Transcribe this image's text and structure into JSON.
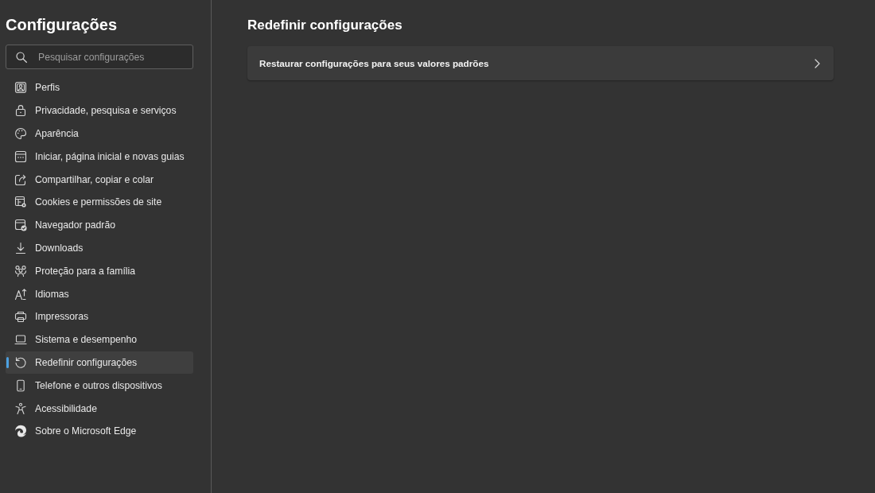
{
  "sidebar": {
    "title": "Configurações",
    "search": {
      "placeholder": "Pesquisar configurações"
    },
    "items": [
      {
        "label": "Perfis",
        "selected": false
      },
      {
        "label": "Privacidade, pesquisa e serviços",
        "selected": false
      },
      {
        "label": "Aparência",
        "selected": false
      },
      {
        "label": "Iniciar, página inicial e novas guias",
        "selected": false
      },
      {
        "label": "Compartilhar, copiar e colar",
        "selected": false
      },
      {
        "label": "Cookies e permissões de site",
        "selected": false
      },
      {
        "label": "Navegador padrão",
        "selected": false
      },
      {
        "label": "Downloads",
        "selected": false
      },
      {
        "label": "Proteção para a família",
        "selected": false
      },
      {
        "label": "Idiomas",
        "selected": false
      },
      {
        "label": "Impressoras",
        "selected": false
      },
      {
        "label": "Sistema e desempenho",
        "selected": false
      },
      {
        "label": "Redefinir configurações",
        "selected": true
      },
      {
        "label": "Telefone e outros dispositivos",
        "selected": false
      },
      {
        "label": "Acessibilidade",
        "selected": false
      },
      {
        "label": "Sobre o Microsoft Edge",
        "selected": false
      }
    ]
  },
  "main": {
    "heading": "Redefinir configurações",
    "options": [
      {
        "label": "Restaurar configurações para seus valores padrões"
      }
    ]
  }
}
